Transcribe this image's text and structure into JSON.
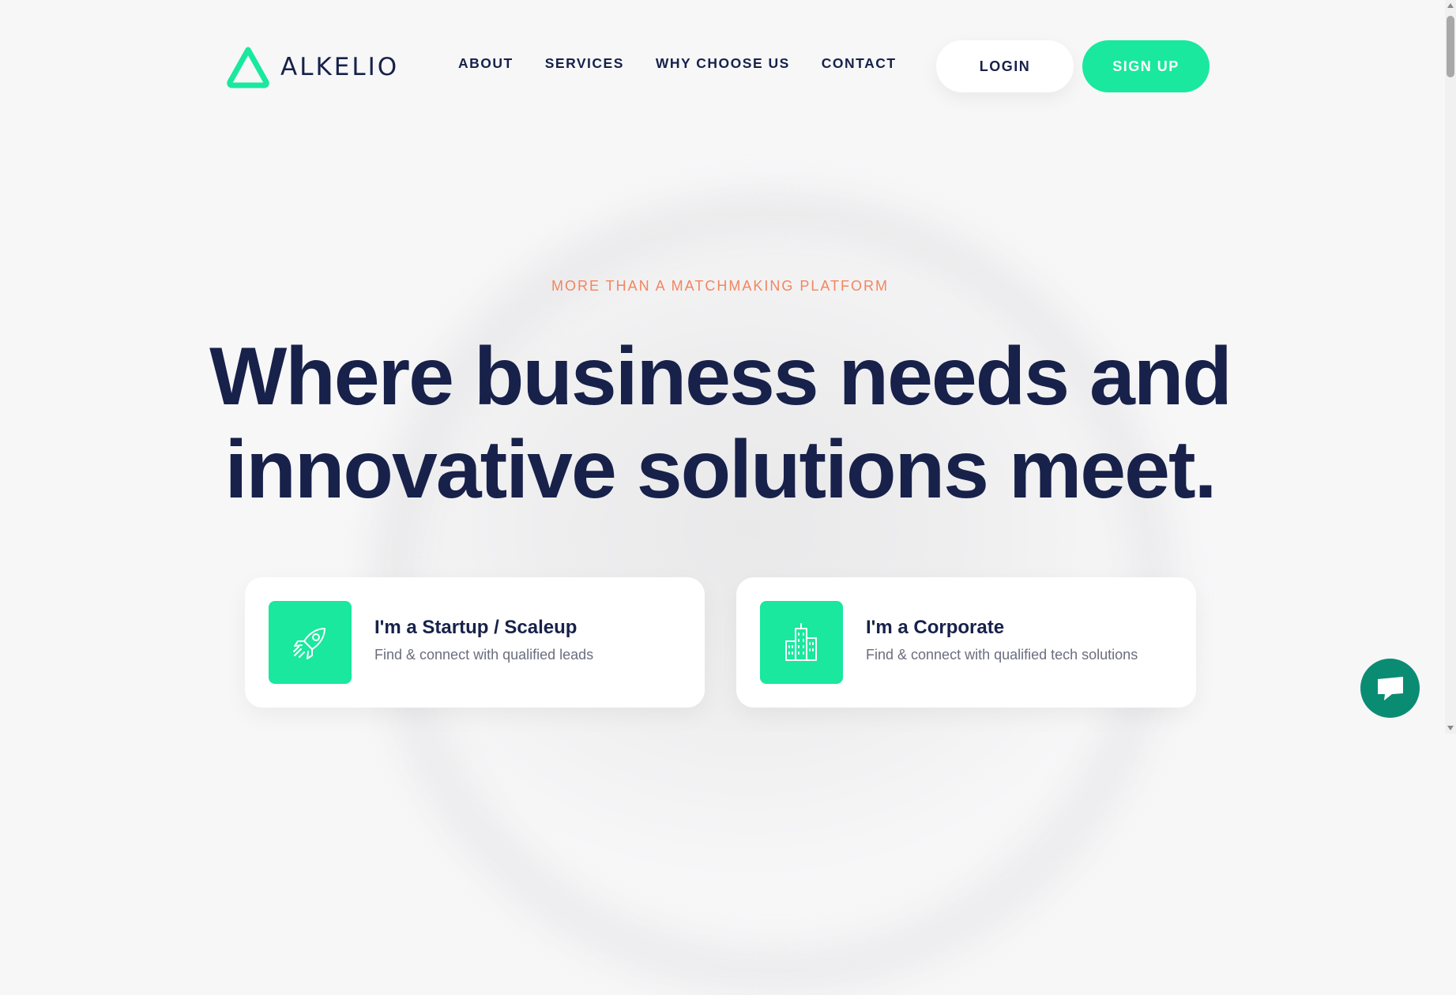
{
  "brand": {
    "name": "ALKELIO",
    "accent": "#19e89e",
    "dark": "#17214a"
  },
  "nav": {
    "items": [
      {
        "label": "ABOUT"
      },
      {
        "label": "SERVICES"
      },
      {
        "label": "WHY CHOOSE US"
      },
      {
        "label": "CONTACT"
      }
    ],
    "login_label": "LOGIN",
    "signup_label": "SIGN UP"
  },
  "hero": {
    "eyebrow": "MORE THAN A MATCHMAKING PLATFORM",
    "headline_line1": "Where business needs and",
    "headline_line2": "innovative solutions meet."
  },
  "cards": [
    {
      "icon": "rocket-icon",
      "title": "I'm a Startup / Scaleup",
      "subtitle": "Find & connect with qualified leads"
    },
    {
      "icon": "building-icon",
      "title": "I'm a Corporate",
      "subtitle": "Find & connect with qualified tech solutions"
    }
  ],
  "chat": {
    "icon": "chat-bubble-icon"
  }
}
